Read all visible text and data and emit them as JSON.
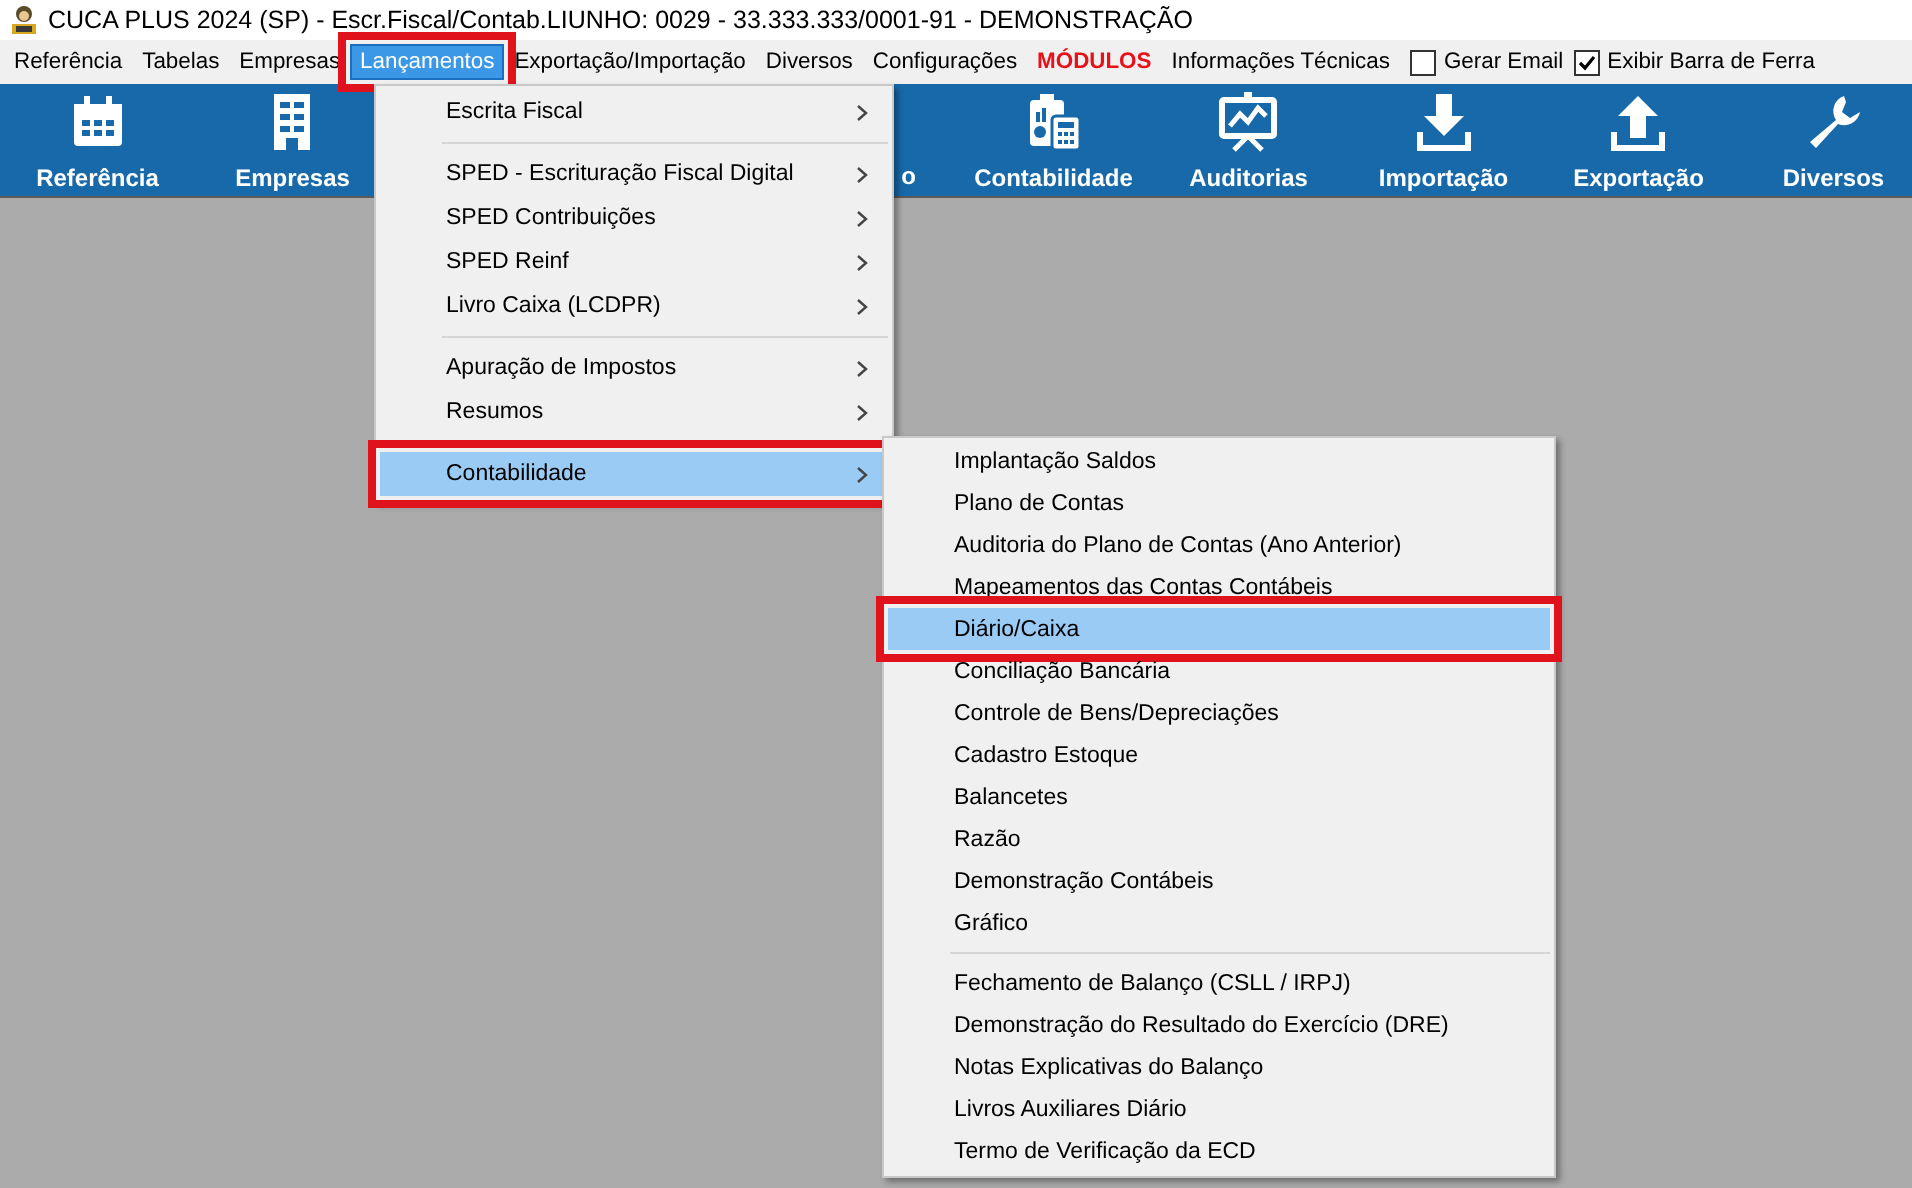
{
  "window": {
    "title": "CUCA PLUS 2024 (SP) - Escr.Fiscal/Contab.LIUNHO: 0029 - 33.333.333/0001-91 - DEMONSTRAÇÃO"
  },
  "menubar": {
    "items": [
      {
        "label": "Referência",
        "kind": "menu",
        "selected": false,
        "annotated": false
      },
      {
        "label": "Tabelas",
        "kind": "menu",
        "selected": false,
        "annotated": false
      },
      {
        "label": "Empresas",
        "kind": "menu",
        "selected": false,
        "annotated": false
      },
      {
        "label": "Lançamentos",
        "kind": "menu",
        "selected": true,
        "annotated": true
      },
      {
        "label": "Exportação/Importação",
        "kind": "menu",
        "selected": false,
        "annotated": false
      },
      {
        "label": "Diversos",
        "kind": "menu",
        "selected": false,
        "annotated": false
      },
      {
        "label": "Configurações",
        "kind": "menu",
        "selected": false,
        "annotated": false
      },
      {
        "label": "MÓDULOS",
        "kind": "module",
        "selected": false,
        "annotated": false
      },
      {
        "label": "Informações Técnicas",
        "kind": "menu",
        "selected": false,
        "annotated": false
      },
      {
        "label": "Gerar Email",
        "kind": "checkbox",
        "checked": false
      },
      {
        "label": "Exibir Barra de Ferra",
        "kind": "checkbox",
        "checked": true
      }
    ]
  },
  "toolbar": {
    "items": [
      {
        "label": "Referência",
        "kind": "button"
      },
      {
        "label": "Empresas",
        "kind": "button"
      },
      {
        "label": "o",
        "kind": "covered"
      },
      {
        "label": "Contabilidade",
        "kind": "button"
      },
      {
        "label": "Auditorias",
        "kind": "button"
      },
      {
        "label": "Importação",
        "kind": "button"
      },
      {
        "label": "Exportação",
        "kind": "button"
      },
      {
        "label": "Diversos",
        "kind": "button"
      }
    ]
  },
  "dropdown": {
    "items": [
      {
        "kind": "item",
        "label": "Escrita Fiscal",
        "submenu": true,
        "selected": false,
        "annotated": false
      },
      {
        "kind": "separator"
      },
      {
        "kind": "item",
        "label": "SPED - Escrituração Fiscal Digital",
        "submenu": true,
        "selected": false,
        "annotated": false
      },
      {
        "kind": "item",
        "label": "SPED Contribuições",
        "submenu": true,
        "selected": false,
        "annotated": false
      },
      {
        "kind": "item",
        "label": "SPED Reinf",
        "submenu": true,
        "selected": false,
        "annotated": false
      },
      {
        "kind": "item",
        "label": "Livro Caixa (LCDPR)",
        "submenu": true,
        "selected": false,
        "annotated": false
      },
      {
        "kind": "separator"
      },
      {
        "kind": "item",
        "label": "Apuração de Impostos",
        "submenu": true,
        "selected": false,
        "annotated": false
      },
      {
        "kind": "item",
        "label": "Resumos",
        "submenu": true,
        "selected": false,
        "annotated": false
      },
      {
        "kind": "separator"
      },
      {
        "kind": "item",
        "label": "Contabilidade",
        "submenu": true,
        "selected": true,
        "annotated": true
      }
    ]
  },
  "submenu": {
    "items": [
      {
        "kind": "item",
        "label": "Implantação Saldos",
        "selected": false,
        "annotated": false
      },
      {
        "kind": "item",
        "label": "Plano de Contas",
        "selected": false,
        "annotated": false
      },
      {
        "kind": "item",
        "label": "Auditoria do Plano de Contas (Ano Anterior)",
        "selected": false,
        "annotated": false
      },
      {
        "kind": "item",
        "label": "Mapeamentos das Contas Contábeis",
        "selected": false,
        "annotated": false
      },
      {
        "kind": "item",
        "label": "Diário/Caixa",
        "selected": true,
        "annotated": true
      },
      {
        "kind": "item",
        "label": "Conciliação Bancária",
        "selected": false,
        "annotated": false
      },
      {
        "kind": "item",
        "label": "Controle de Bens/Depreciações",
        "selected": false,
        "annotated": false
      },
      {
        "kind": "item",
        "label": "Cadastro Estoque",
        "selected": false,
        "annotated": false
      },
      {
        "kind": "item",
        "label": "Balancetes",
        "selected": false,
        "annotated": false
      },
      {
        "kind": "item",
        "label": "Razão",
        "selected": false,
        "annotated": false
      },
      {
        "kind": "item",
        "label": "Demonstração Contábeis",
        "selected": false,
        "annotated": false
      },
      {
        "kind": "item",
        "label": "Gráfico",
        "selected": false,
        "annotated": false
      },
      {
        "kind": "separator"
      },
      {
        "kind": "item",
        "label": "Fechamento de Balanço (CSLL / IRPJ)",
        "selected": false,
        "annotated": false
      },
      {
        "kind": "item",
        "label": "Demonstração do Resultado do Exercício (DRE)",
        "selected": false,
        "annotated": false
      },
      {
        "kind": "item",
        "label": "Notas Explicativas do Balanço",
        "selected": false,
        "annotated": false
      },
      {
        "kind": "item",
        "label": "Livros Auxiliares Diário",
        "selected": false,
        "annotated": false
      },
      {
        "kind": "item",
        "label": "Termo de Verificação da ECD",
        "selected": false,
        "annotated": false
      }
    ]
  }
}
